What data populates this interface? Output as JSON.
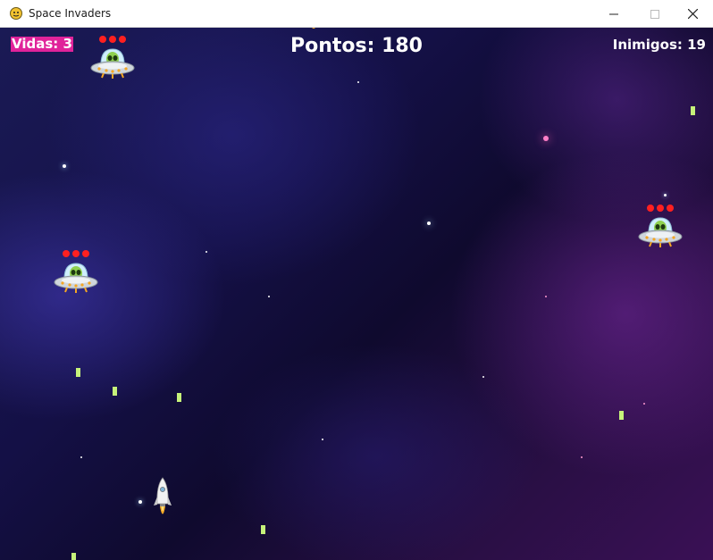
{
  "window": {
    "title": "Space Invaders"
  },
  "hud": {
    "lives_label": "Vidas: 3",
    "lives": 3,
    "score_label": "Pontos: 180",
    "score": 180,
    "enemies_label": "Inimigos: 19",
    "enemies": 19
  },
  "enemies": [
    {
      "name": "alien-ufo",
      "health": 3
    },
    {
      "name": "alien-ufo",
      "health": 3
    },
    {
      "name": "alien-ufo",
      "health": 3
    }
  ],
  "colors": {
    "lives_badge": "#e0239a",
    "bullet": "#c6f27a",
    "health_dot": "#ff2020"
  },
  "icons": [
    "pygame-icon",
    "minimize-icon",
    "maximize-icon",
    "close-icon",
    "ufo-icon",
    "rocket-icon"
  ]
}
